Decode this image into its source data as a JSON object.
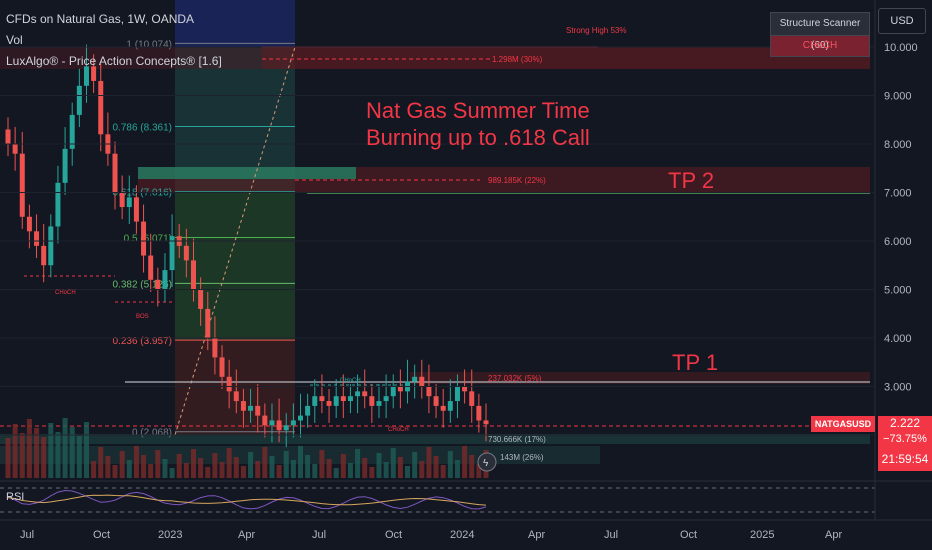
{
  "header": {
    "symbol": "CFDs on Natural Gas, 1W, OANDA",
    "vol": "Vol",
    "indicator": "LuxAlgo® - Price Action Concepts® [1.6]"
  },
  "panel": {
    "title": "Structure Scanner (60)",
    "signal": "CHoCH"
  },
  "currency": "USD",
  "symbol_tag": "NATGASUSD",
  "price": {
    "last": "2.222",
    "change": "−73.75%",
    "countdown": "21:59:54"
  },
  "rsi_label": "RSI",
  "annotations": {
    "headline_line1": "Nat Gas Summer Time",
    "headline_line2": "Burning up to .618 Call",
    "tp2": "TP 2",
    "tp1": "TP 1",
    "strong_high": "Strong High 53%",
    "vol_1298": "1.298M (30%)",
    "vol_989": "989.185K (22%)",
    "vol_237": "237.032K (5%)",
    "vol_730": "730.666K (17%)",
    "vol_143": "143M (26%)",
    "choch_1": "CHoCH",
    "choch_2": "CHoCH",
    "choch_3": "CHoCH",
    "bos": "BOS"
  },
  "fib_labels": [
    "1 (10.074)",
    "0.786 (8.361)",
    "0.618 (7.016)",
    "0.5 (6.071)",
    "0.382 (5.126)",
    "0.236 (3.957)",
    "0 (2.068)"
  ],
  "colors": {
    "bull": "#26a69a",
    "bear": "#ef5350",
    "bg": "#131722",
    "accent_red": "#f23645"
  },
  "chart_data": {
    "type": "candlestick",
    "timeframe": "1W",
    "y_axis": {
      "ticks": [
        "10.000",
        "9.000",
        "8.000",
        "7.000",
        "6.000",
        "5.000",
        "4.000",
        "3.000",
        "2.000"
      ],
      "range": [
        2.0,
        10.0
      ]
    },
    "x_axis": {
      "ticks": [
        "Jul",
        "Oct",
        "2023",
        "Apr",
        "Jul",
        "Oct",
        "2024",
        "Apr",
        "Jul",
        "Oct",
        "2025",
        "Apr"
      ]
    },
    "fib_levels": [
      {
        "ratio": 1,
        "price": 10.074
      },
      {
        "ratio": 0.786,
        "price": 8.361
      },
      {
        "ratio": 0.618,
        "price": 7.016
      },
      {
        "ratio": 0.5,
        "price": 6.071
      },
      {
        "ratio": 0.382,
        "price": 5.126
      },
      {
        "ratio": 0.236,
        "price": 3.957
      },
      {
        "ratio": 0,
        "price": 2.068
      }
    ],
    "targets": [
      {
        "label": "TP 2",
        "price": 7.0
      },
      {
        "label": "TP 1",
        "price": 3.1
      }
    ],
    "close_series": [
      8.0,
      7.8,
      6.5,
      6.2,
      5.9,
      5.5,
      6.3,
      7.2,
      7.9,
      8.6,
      9.2,
      9.6,
      9.3,
      8.2,
      7.8,
      7.0,
      6.7,
      6.9,
      6.4,
      5.7,
      5.2,
      5.0,
      5.4,
      6.1,
      5.9,
      5.6,
      5.0,
      4.6,
      4.0,
      3.6,
      3.2,
      2.9,
      2.7,
      2.5,
      2.6,
      2.4,
      2.2,
      2.3,
      2.1,
      2.2,
      2.3,
      2.4,
      2.6,
      2.8,
      2.7,
      2.6,
      2.8,
      2.7,
      2.8,
      2.9,
      2.8,
      2.6,
      2.7,
      2.8,
      3.0,
      2.9,
      3.1,
      3.2,
      3.0,
      2.8,
      2.6,
      2.5,
      2.7,
      3.0,
      2.9,
      2.6,
      2.3,
      2.222
    ]
  }
}
